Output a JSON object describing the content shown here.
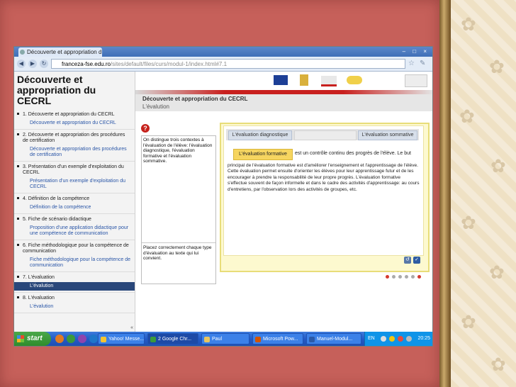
{
  "browser": {
    "tab_title": "Découverte et appropriation d",
    "url_domain": "franceza-fse.edu.ro",
    "url_path": "/sites/default/files/curs/modul-1/index.html#7.1",
    "window_controls": "– □ ×"
  },
  "sidebar": {
    "title": "Découverte et appropriation du CECRL",
    "sections": [
      {
        "label": "1. Découverte et appropriation du CECRL",
        "sub": [
          "Découverte et appropriation du CECRL"
        ]
      },
      {
        "label": "2. Découverte et appropriation des procédures de certification",
        "sub": [
          "Découverte et appropriation des procédures de certification"
        ]
      },
      {
        "label": "3. Présentation d'un exemple d'exploitation du CECRL",
        "sub": [
          "Présentation d'un exemple d'exploitation du CECRL"
        ]
      },
      {
        "label": "4. Définition de la compétence",
        "sub": [
          "Définition de la compétence"
        ]
      },
      {
        "label": "5. Fiche de scénario didactique",
        "sub": [
          "Proposition d'une application didactique pour une compétence de communication"
        ]
      },
      {
        "label": "6. Fiche méthodologique pour la compétence de communication",
        "sub": [
          "Fiche méthodologique pour la compétence de communication"
        ]
      },
      {
        "label": "7. L'évaluation",
        "sub": [
          "L'évalution"
        ]
      },
      {
        "label": "8. L'évaluation",
        "sub": [
          "L'évalution"
        ]
      }
    ],
    "collapse": "«"
  },
  "module": {
    "title": "Découverte et appropriation du CECRL",
    "subtitle": "L'évalution"
  },
  "instructions": {
    "text1": "On distingue trois contextes à l'évaluation de l'élève: l'évaluation diagnostique, l'évaluation formative et l'évaluation sommative.",
    "text2": "Placez correctement chaque type d'évaluation au texte qui lui convient."
  },
  "exercise": {
    "slot1": "L'évaluation diagnostique",
    "slot3": "L'évaluation sommative",
    "drag_tag": "L'évaluation formative",
    "line1": "est un contrôle continu des progrès de l'élève. Le but",
    "paragraph": "principal de l'évaluation formative est d'améliorer l'enseignement et l'apprentissage de l'élève. Cette évaluation permet ensuite d'orienter les élèves pour leur apprentissage futur et de les encourager à prendre la responsabilité de leur propre progrès. L'évaluation formative s'effectue souvent de façon informelle et dans le cadre des activités d'apprentissage: au cours d'entretiens, par l'observation lors des activités de groupes, etc."
  },
  "taskbar": {
    "start": "start",
    "tasks": [
      "Yahoo! Messe...",
      "2 Google Chr...",
      "Paul",
      "Microsoft Pow...",
      "Manuel-Modul..."
    ],
    "lang": "EN",
    "clock": "20:25"
  },
  "colors": {
    "brand_red": "#c8201e",
    "nav_active": "#29477a",
    "exercise_bg": "#fdf9cf",
    "drag_tag": "#f6d560"
  }
}
